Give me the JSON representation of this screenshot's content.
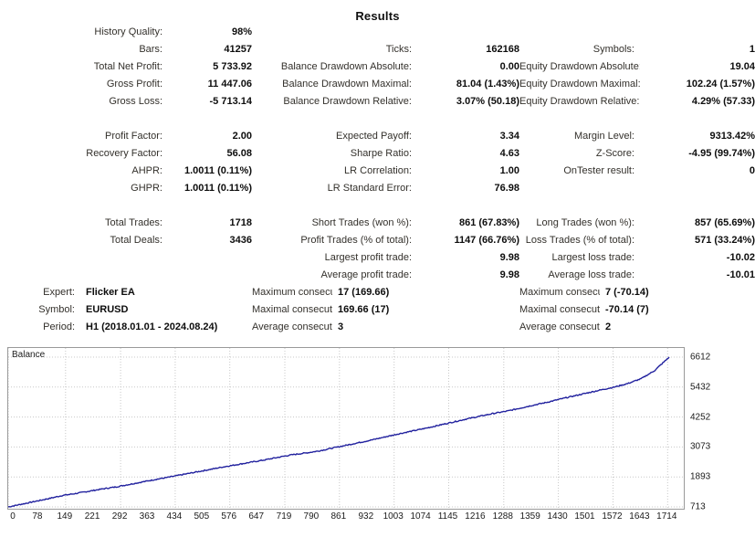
{
  "title": "Results",
  "stats": {
    "rows": [
      [
        {
          "label": "History Quality:",
          "value": "98%"
        },
        {
          "label": "",
          "value": ""
        },
        {
          "label": "",
          "value": ""
        }
      ],
      [
        {
          "label": "Bars:",
          "value": "41257"
        },
        {
          "label": "Ticks:",
          "value": "162168"
        },
        {
          "label": "Symbols:",
          "value": "1"
        }
      ],
      [
        {
          "label": "Total Net Profit:",
          "value": "5 733.92"
        },
        {
          "label": "Balance Drawdown Absolute:",
          "value": "0.00"
        },
        {
          "label": "Equity Drawdown Absolute:",
          "value": "19.04"
        }
      ],
      [
        {
          "label": "Gross Profit:",
          "value": "11 447.06"
        },
        {
          "label": "Balance Drawdown Maximal:",
          "value": "81.04 (1.43%)"
        },
        {
          "label": "Equity Drawdown Maximal:",
          "value": "102.24 (1.57%)"
        }
      ],
      [
        {
          "label": "Gross Loss:",
          "value": "-5 713.14"
        },
        {
          "label": "Balance Drawdown Relative:",
          "value": "3.07% (50.18)"
        },
        {
          "label": "Equity Drawdown Relative:",
          "value": "4.29% (57.33)"
        }
      ],
      [
        {
          "label": "Profit Factor:",
          "value": "2.00"
        },
        {
          "label": "Expected Payoff:",
          "value": "3.34"
        },
        {
          "label": "Margin Level:",
          "value": "9313.42%"
        }
      ],
      [
        {
          "label": "Recovery Factor:",
          "value": "56.08"
        },
        {
          "label": "Sharpe Ratio:",
          "value": "4.63"
        },
        {
          "label": "Z-Score:",
          "value": "-4.95 (99.74%)"
        }
      ],
      [
        {
          "label": "AHPR:",
          "value": "1.0011 (0.11%)"
        },
        {
          "label": "LR Correlation:",
          "value": "1.00"
        },
        {
          "label": "OnTester result:",
          "value": "0"
        }
      ],
      [
        {
          "label": "GHPR:",
          "value": "1.0011 (0.11%)"
        },
        {
          "label": "LR Standard Error:",
          "value": "76.98"
        },
        {
          "label": "",
          "value": ""
        }
      ],
      [
        {
          "label": "Total Trades:",
          "value": "1718"
        },
        {
          "label": "Short Trades (won %):",
          "value": "861 (67.83%)"
        },
        {
          "label": "Long Trades (won %):",
          "value": "857 (65.69%)"
        }
      ],
      [
        {
          "label": "Total Deals:",
          "value": "3436"
        },
        {
          "label": "Profit Trades (% of total):",
          "value": "1147 (66.76%)"
        },
        {
          "label": "Loss Trades (% of total):",
          "value": "571 (33.24%)"
        }
      ],
      [
        {
          "label": "",
          "value": ""
        },
        {
          "label": "Largest profit trade:",
          "value": "9.98"
        },
        {
          "label": "Largest loss trade:",
          "value": "-10.02"
        }
      ],
      [
        {
          "label": "",
          "value": ""
        },
        {
          "label": "Average profit trade:",
          "value": "9.98"
        },
        {
          "label": "Average loss trade:",
          "value": "-10.01"
        }
      ]
    ],
    "meta_rows": [
      {
        "label": "Expert:",
        "value": "Flicker EA",
        "mid_label": "Maximum consecutive wins ($):",
        "mid_value": "17 (169.66)",
        "right_label": "Maximum consecutive losses ($):",
        "right_value": "7 (-70.14)"
      },
      {
        "label": "Symbol:",
        "value": "EURUSD",
        "mid_label": "Maximal consecutive profit (count):",
        "mid_value": "169.66 (17)",
        "right_label": "Maximal consecutive loss (count):",
        "right_value": "-70.14 (7)"
      },
      {
        "label": "Period:",
        "value": "H1 (2018.01.01 - 2024.08.24)",
        "mid_label": "Average consecutive wins:",
        "mid_value": "3",
        "right_label": "Average consecutive losses:",
        "right_value": "2"
      }
    ]
  },
  "chart_data": {
    "type": "line",
    "title": "",
    "legend": "Balance",
    "legend_position": "top-left",
    "xlabel": "",
    "ylabel": "",
    "line_color": "#21219e",
    "grid": true,
    "xlim": [
      0,
      1756
    ],
    "ylim": [
      713,
      6612
    ],
    "ytick_labels": [
      "6612",
      "5432",
      "4252",
      "3073",
      "1893",
      "713"
    ],
    "ytick_values": [
      6612,
      5432,
      4252,
      3073,
      1893,
      713
    ],
    "xtick_labels": [
      "0",
      "78",
      "149",
      "221",
      "292",
      "363",
      "434",
      "505",
      "576",
      "647",
      "719",
      "790",
      "861",
      "932",
      "1003",
      "1074",
      "1145",
      "1216",
      "1288",
      "1359",
      "1430",
      "1501",
      "1572",
      "1643",
      "1714"
    ],
    "xtick_values": [
      0,
      78,
      149,
      221,
      292,
      363,
      434,
      505,
      576,
      647,
      719,
      790,
      861,
      932,
      1003,
      1074,
      1145,
      1216,
      1288,
      1359,
      1430,
      1501,
      1572,
      1643,
      1714
    ],
    "series": [
      {
        "name": "Balance",
        "x": [
          0,
          35,
          70,
          105,
          140,
          175,
          210,
          245,
          280,
          315,
          350,
          385,
          420,
          455,
          490,
          525,
          560,
          595,
          630,
          665,
          700,
          735,
          770,
          805,
          840,
          875,
          910,
          945,
          980,
          1015,
          1050,
          1085,
          1120,
          1155,
          1190,
          1225,
          1260,
          1295,
          1330,
          1365,
          1400,
          1435,
          1470,
          1505,
          1540,
          1575,
          1610,
          1645,
          1680,
          1718
        ],
        "y": [
          713,
          820,
          930,
          1040,
          1160,
          1240,
          1330,
          1420,
          1500,
          1600,
          1700,
          1800,
          1890,
          1990,
          2090,
          2190,
          2290,
          2380,
          2470,
          2560,
          2660,
          2760,
          2830,
          2910,
          3020,
          3130,
          3240,
          3350,
          3470,
          3590,
          3700,
          3810,
          3930,
          4050,
          4170,
          4280,
          4390,
          4480,
          4600,
          4720,
          4830,
          4960,
          5080,
          5200,
          5320,
          5430,
          5570,
          5760,
          6080,
          6612
        ]
      }
    ]
  }
}
